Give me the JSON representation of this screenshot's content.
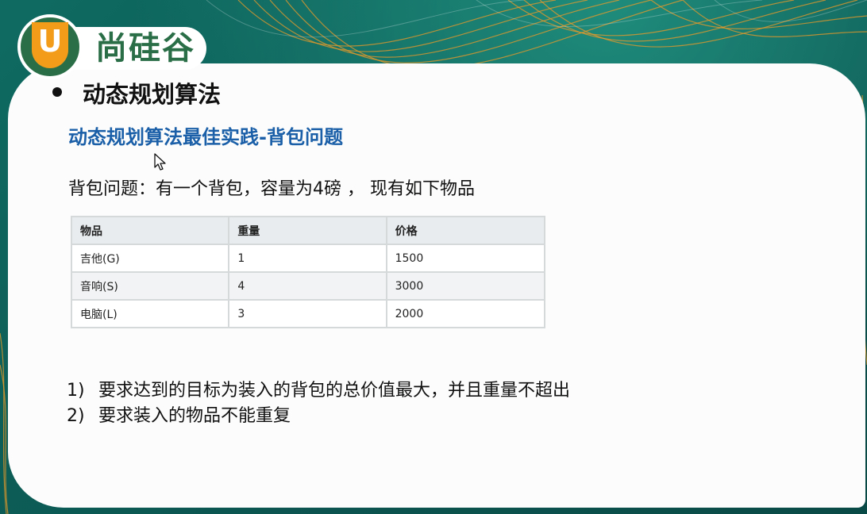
{
  "logo": {
    "letter": "U",
    "name": "尚硅谷"
  },
  "heading": "动态规划算法",
  "subtitle": "动态规划算法最佳实践-背包问题",
  "intro": "背包问题：有一个背包，容量为4磅 ， 现有如下物品",
  "table": {
    "headers": [
      "物品",
      "重量",
      "价格"
    ],
    "rows": [
      [
        "吉他(G)",
        "1",
        "1500"
      ],
      [
        "音响(S)",
        "4",
        "3000"
      ],
      [
        "电脑(L)",
        "3",
        "2000"
      ]
    ]
  },
  "requirements": [
    {
      "num": "1)",
      "text": "要求达到的目标为装入的背包的总价值最大，并且重量不超出"
    },
    {
      "num": "2)",
      "text": "要求装入的物品不能重复"
    }
  ],
  "colors": {
    "background": "#0d5a55",
    "accent_orange": "#f29c1a",
    "logo_green": "#2a6e47",
    "subtitle_blue": "#1a5fa8"
  }
}
